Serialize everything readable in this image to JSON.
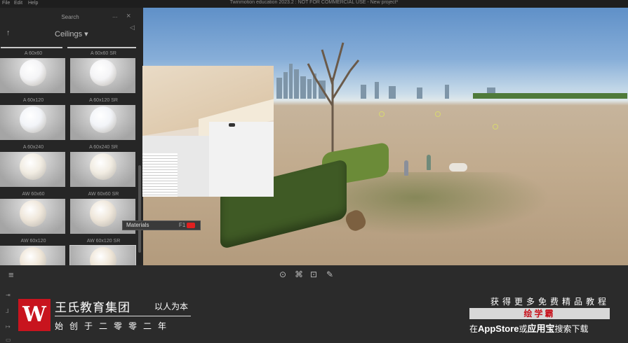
{
  "menu": {
    "file": "File",
    "edit": "Edit",
    "help": "Help"
  },
  "window_title": "Twinmotion education 2023.2 : NOT FOR COMMERCIAL USE - New project*",
  "library": {
    "search_label": "Search",
    "more": "...",
    "close": "×",
    "collapse": "◁",
    "up": "↑",
    "category": "Ceilings ▾",
    "items": [
      {
        "label": "A 60x60",
        "color": "#f4f4f6"
      },
      {
        "label": "A 60x60 SR",
        "color": "#f4f4f6"
      },
      {
        "label": "A 60x120",
        "color": "#f2f4f8"
      },
      {
        "label": "A 60x120 SR",
        "color": "#f2f4f8"
      },
      {
        "label": "A 60x240",
        "color": "#f1ece2"
      },
      {
        "label": "A 60x240 SR",
        "color": "#f1ece2"
      },
      {
        "label": "AW 60x60",
        "color": "#efe7db"
      },
      {
        "label": "AW 60x60 SR",
        "color": "#efe7db"
      },
      {
        "label": "AW 60x120",
        "color": "#efe6d8"
      },
      {
        "label": "AW 60x120 SR",
        "color": "#efe6d8"
      }
    ]
  },
  "tooltip": {
    "label": "Materials",
    "shortcut": "F1"
  },
  "viewport": {
    "eye": "👁",
    "arrow": "◁"
  },
  "toolbar": {
    "menu": "≡",
    "tools": [
      "⊙",
      "⌘",
      "⊡",
      "✎"
    ]
  },
  "banner": {
    "logo": "W",
    "title": "王氏教育集团",
    "slogan": "以人为本",
    "subtitle": "始创于二零零二年",
    "right_line1": "获得更多免费精品教程",
    "right_line2": "绘学霸",
    "right_line3_pre": "在",
    "right_line3_app1": "AppStore",
    "right_line3_mid": "或",
    "right_line3_app2": "应用宝",
    "right_line3_post": "搜索下载",
    "side_icons": [
      "⇥",
      "⅃",
      "↦",
      "▭"
    ]
  }
}
